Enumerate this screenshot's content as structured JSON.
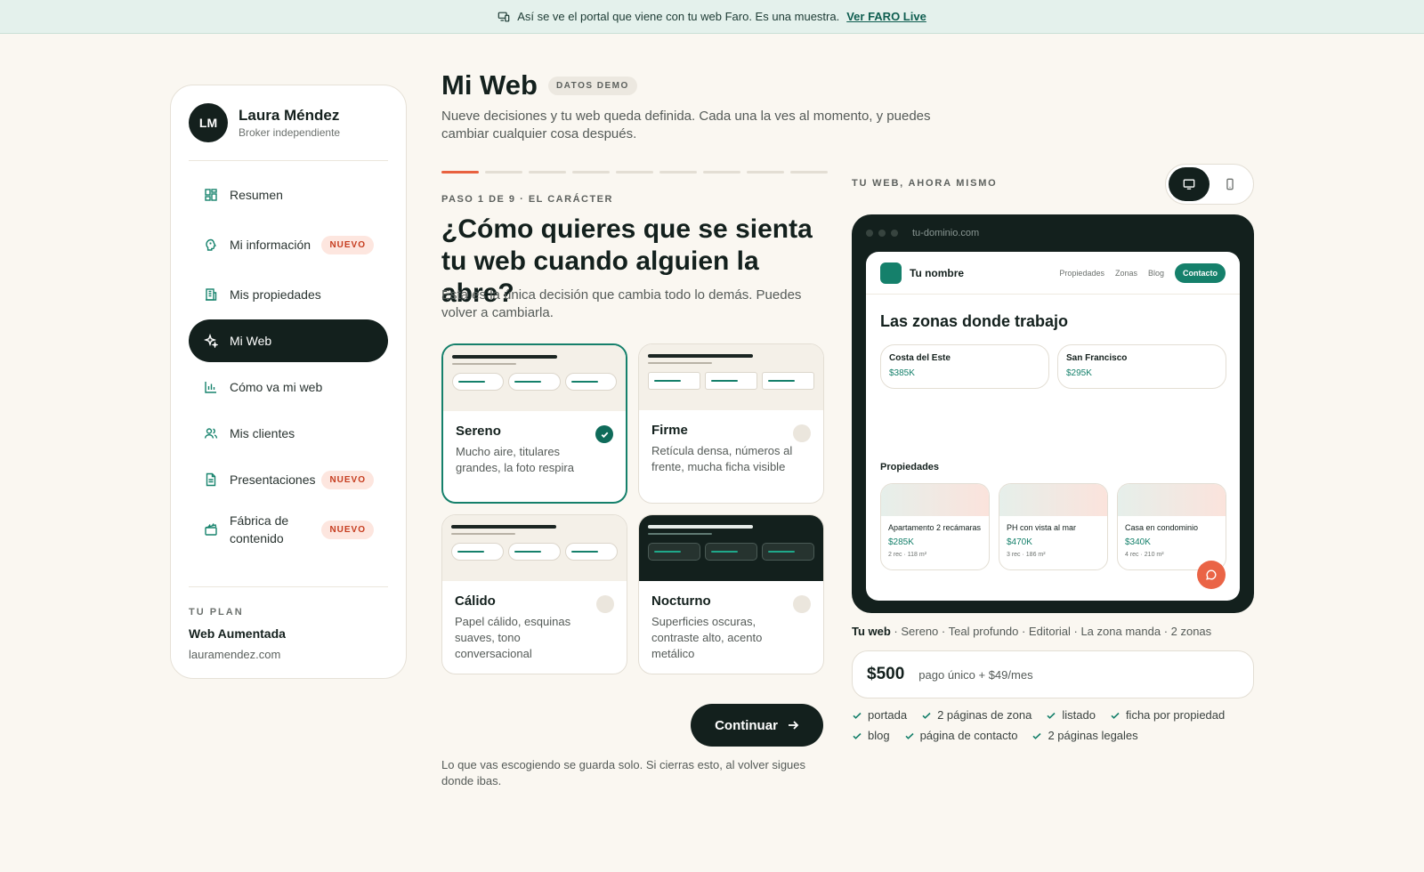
{
  "banner": {
    "text": "Así se ve el portal que viene con tu web Faro. Es una muestra.",
    "link": "Ver FARO Live"
  },
  "sidebar": {
    "user": {
      "initials": "LM",
      "name": "Laura Méndez",
      "role": "Broker independiente"
    },
    "items": [
      {
        "label": "Resumen",
        "badge": ""
      },
      {
        "label": "Mi información",
        "badge": "NUEVO"
      },
      {
        "label": "Mis propiedades",
        "badge": ""
      },
      {
        "label": "Mi Web",
        "badge": ""
      },
      {
        "label": "Cómo va mi web",
        "badge": ""
      },
      {
        "label": "Mis clientes",
        "badge": ""
      },
      {
        "label": "Presentaciones",
        "badge": "NUEVO"
      },
      {
        "label": "Fábrica de contenido",
        "badge": "NUEVO"
      }
    ],
    "plan": {
      "heading": "TU PLAN",
      "name": "Web Aumentada",
      "domain": "lauramendez.com"
    }
  },
  "main": {
    "title": "Mi Web",
    "demo_badge": "DATOS DEMO",
    "subtitle": "Nueve decisiones y tu web queda definida. Cada una la ves al momento, y puedes cambiar cualquier cosa después.",
    "progress": {
      "current": 1,
      "total": 9
    },
    "step_label": "PASO 1 DE 9 · EL CARÁCTER",
    "question": "¿Cómo quieres que se sienta tu web cuando alguien la abre?",
    "question_desc": "Esta es la única decisión que cambia todo lo demás. Puedes volver a cambiarla.",
    "options": [
      {
        "name": "Sereno",
        "desc": "Mucho aire, titulares grandes, la foto respira",
        "selected": true
      },
      {
        "name": "Firme",
        "desc": "Retícula densa, números al frente, mucha ficha visible",
        "selected": false
      },
      {
        "name": "Cálido",
        "desc": "Papel cálido, esquinas suaves, tono conversacional",
        "selected": false
      },
      {
        "name": "Nocturno",
        "desc": "Superficies oscuras, contraste alto, acento metálico",
        "selected": false
      }
    ],
    "continue_label": "Continuar",
    "note": "Lo que vas escogiendo se guarda solo. Si cierras esto, al volver sigues donde ibas."
  },
  "preview": {
    "label": "TU WEB, AHORA MISMO",
    "url": "tu-dominio.com",
    "site": {
      "name": "Tu nombre",
      "nav": [
        "Propiedades",
        "Zonas",
        "Blog"
      ],
      "contact": "Contacto",
      "heading": "Las zonas donde trabajo",
      "zones": [
        {
          "name": "Costa del Este",
          "price": "$385K"
        },
        {
          "name": "San Francisco",
          "price": "$295K"
        }
      ],
      "props_heading": "Propiedades",
      "properties": [
        {
          "title": "Apartamento 2 recámaras",
          "price": "$285K",
          "meta": "2 rec · 118 m²"
        },
        {
          "title": "PH con vista al mar",
          "price": "$470K",
          "meta": "3 rec · 186 m²"
        },
        {
          "title": "Casa en condominio",
          "price": "$340K",
          "meta": "4 rec · 210 m²"
        }
      ]
    },
    "summary_label": "Tu web",
    "summary_text": " · Sereno · Teal profundo · Editorial · La zona manda · 2 zonas",
    "price": "$500",
    "price_terms": "pago único + $49/mes",
    "features": [
      "portada",
      "2 páginas de zona",
      "listado",
      "ficha por propiedad",
      "blog",
      "página de contacto",
      "2 páginas legales"
    ]
  },
  "colors": {
    "accent": "#15806b",
    "dark": "#13201d",
    "coral": "#e8613f",
    "background": "#faf7f1"
  }
}
